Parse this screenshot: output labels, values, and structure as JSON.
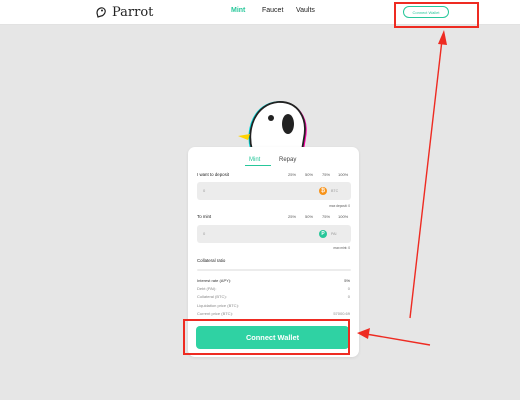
{
  "header": {
    "brand": "Parrot",
    "nav": [
      "Mint",
      "Faucet",
      "Vaults"
    ],
    "connect_wallet": "Connect Wallet"
  },
  "card": {
    "tabs": [
      "Mint",
      "Repay"
    ],
    "deposit": {
      "label": "I want to deposit",
      "percents": [
        "25%",
        "50%",
        "75%",
        "100%"
      ],
      "input_value": "0",
      "token": "BTC",
      "token_icon": "bitcoin-icon",
      "max_text": "max deposit: 0"
    },
    "mint": {
      "label": "To mint",
      "percents": [
        "25%",
        "50%",
        "75%",
        "100%"
      ],
      "input_value": "0",
      "token": "PAI",
      "token_icon": "pai-icon",
      "max_text": "max mint: 0"
    },
    "collateral_ratio_label": "Collateral ratio",
    "details": [
      {
        "label": "Interest rate (APY):",
        "value": "5%"
      },
      {
        "label": "Debt (PAI):",
        "value": "0"
      },
      {
        "label": "Collateral (BTC):",
        "value": "0"
      },
      {
        "label": "Liquidation price (BTC):",
        "value": ""
      },
      {
        "label": "Current price (BTC):",
        "value": "57000.69"
      }
    ],
    "connect_button": "Connect Wallet"
  },
  "colors": {
    "accent": "#27c79a",
    "button": "#2fd2a3",
    "annotation": "#ee2b22",
    "btc": "#f7931a",
    "pai": "#27c79a"
  }
}
